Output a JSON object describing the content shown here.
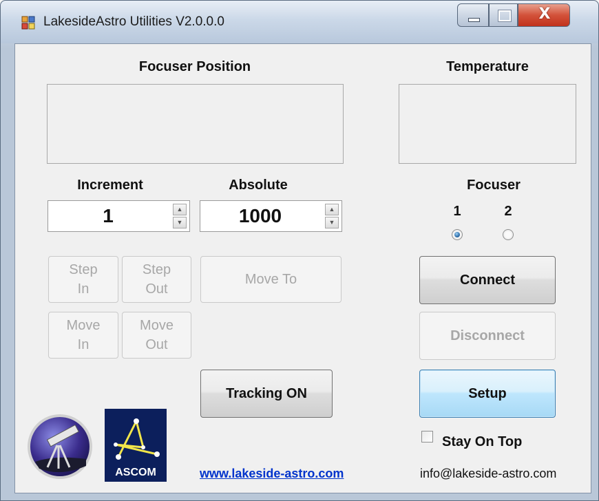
{
  "window": {
    "title": "LakesideAstro Utilities V2.0.0.0",
    "close_glyph": "X"
  },
  "labels": {
    "focuser_position": "Focuser Position",
    "temperature": "Temperature",
    "increment": "Increment",
    "absolute": "Absolute",
    "focuser": "Focuser",
    "focuser_1": "1",
    "focuser_2": "2"
  },
  "fields": {
    "increment_value": "1",
    "absolute_value": "1000",
    "focuser_position_value": "",
    "temperature_value": ""
  },
  "buttons": {
    "step_in": "Step\nIn",
    "step_out": "Step\nOut",
    "move_to": "Move To",
    "move_in": "Move\nIn",
    "move_out": "Move\nOut",
    "tracking": "Tracking ON",
    "connect": "Connect",
    "disconnect": "Disconnect",
    "setup": "Setup"
  },
  "options": {
    "selected_focuser": 1,
    "stay_on_top_label": "Stay On Top",
    "stay_on_top_checked": false
  },
  "footer": {
    "website": "www.lakeside-astro.com",
    "email": "info@lakeside-astro.com",
    "ascom_label": "ASCOM"
  },
  "colors": {
    "link": "#0033cc",
    "disabled_text": "#a7a7a7",
    "focus_border": "#3c7fb1"
  }
}
